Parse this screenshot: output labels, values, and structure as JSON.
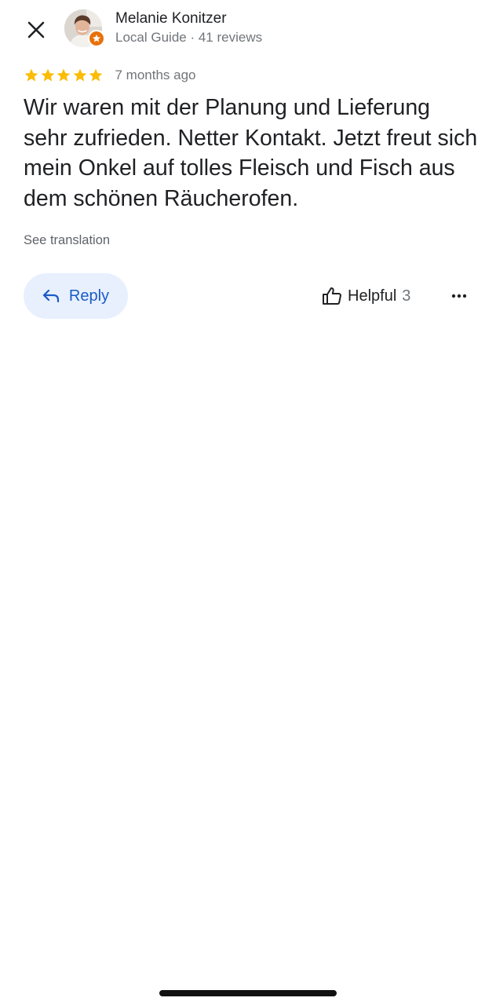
{
  "header": {
    "close_icon": "close-icon",
    "author": {
      "name": "Melanie Konitzer",
      "meta": "Local Guide · 41 reviews",
      "avatar_icon": "avatar",
      "badge_icon": "local-guide-star-badge-icon",
      "badge_color": "#e8710a"
    }
  },
  "review": {
    "rating": 5,
    "max_rating": 5,
    "star_color": "#fbbc04",
    "age": "7 months ago",
    "text": "Wir waren mit der Planung und Lieferung sehr zufrieden. Netter Kontakt. Jetzt freut sich mein Onkel auf tolles Fleisch und Fisch aus dem schönen Räucherofen.",
    "see_translation": "See translation"
  },
  "actions": {
    "reply": {
      "label": "Reply",
      "icon": "reply-arrow-icon",
      "background": "#e8f0fe",
      "text_color": "#1a5bc8"
    },
    "helpful": {
      "label": "Helpful",
      "count": "3",
      "icon": "thumbs-up-icon"
    },
    "more_icon": "more-horizontal-icon"
  }
}
